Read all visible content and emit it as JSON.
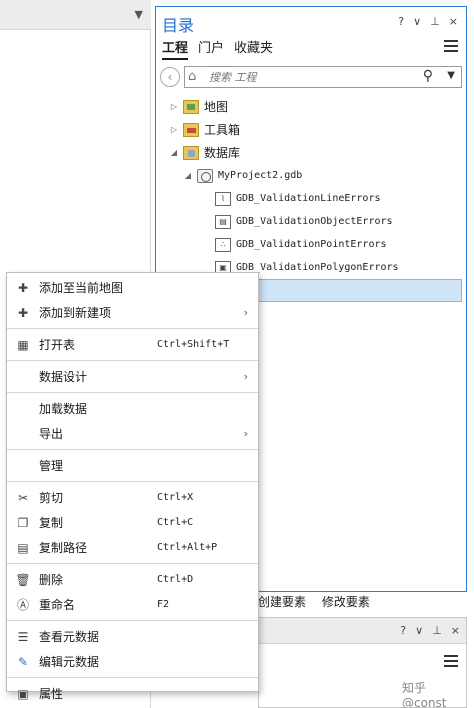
{
  "catalog": {
    "title": "目录",
    "controls": [
      "?",
      "∨",
      "⊥",
      "×"
    ],
    "tabs": [
      {
        "label": "工程",
        "active": true
      },
      {
        "label": "门户",
        "active": false
      },
      {
        "label": "收藏夹",
        "active": false
      }
    ],
    "search": {
      "placeholder": "搜索 工程"
    },
    "tree": {
      "maps": "地图",
      "toolboxes": "工具箱",
      "databases": "数据库",
      "gdb": "MyProject2.gdb",
      "items": [
        "GDB_ValidationLineErrors",
        "GDB_ValidationObjectErrors",
        "GDB_ValidationPointErrors",
        "GDB_ValidationPolygonErrors"
      ]
    }
  },
  "bottom_tabs": [
    "创建要素",
    "修改要素"
  ],
  "lower_panel": {
    "controls": [
      "?",
      "∨",
      "⊥",
      "×"
    ]
  },
  "watermark": "知乎 @const",
  "context_menu": {
    "add_to_map": "添加至当前地图",
    "add_to_new": "添加到新建项",
    "open_table": "打开表",
    "open_table_sc": "Ctrl+Shift+T",
    "data_design": "数据设计",
    "load_data": "加载数据",
    "export": "导出",
    "manage": "管理",
    "cut": "剪切",
    "cut_sc": "Ctrl+X",
    "copy": "复制",
    "copy_sc": "Ctrl+C",
    "copy_path": "复制路径",
    "copy_path_sc": "Ctrl+Alt+P",
    "delete": "删除",
    "delete_sc": "Ctrl+D",
    "rename": "重命名",
    "rename_sc": "F2",
    "view_metadata": "查看元数据",
    "edit_metadata": "编辑元数据",
    "properties": "属性"
  },
  "icons": {
    "left_header": "chevron-down-icon",
    "menu": [
      "star-add-icon",
      "star-new-icon",
      "table-icon",
      "scissors-icon",
      "copy-icon",
      "copy-path-icon",
      "trash-icon",
      "rename-icon",
      "metadata-view-icon",
      "pencil-icon",
      "properties-icon"
    ]
  }
}
